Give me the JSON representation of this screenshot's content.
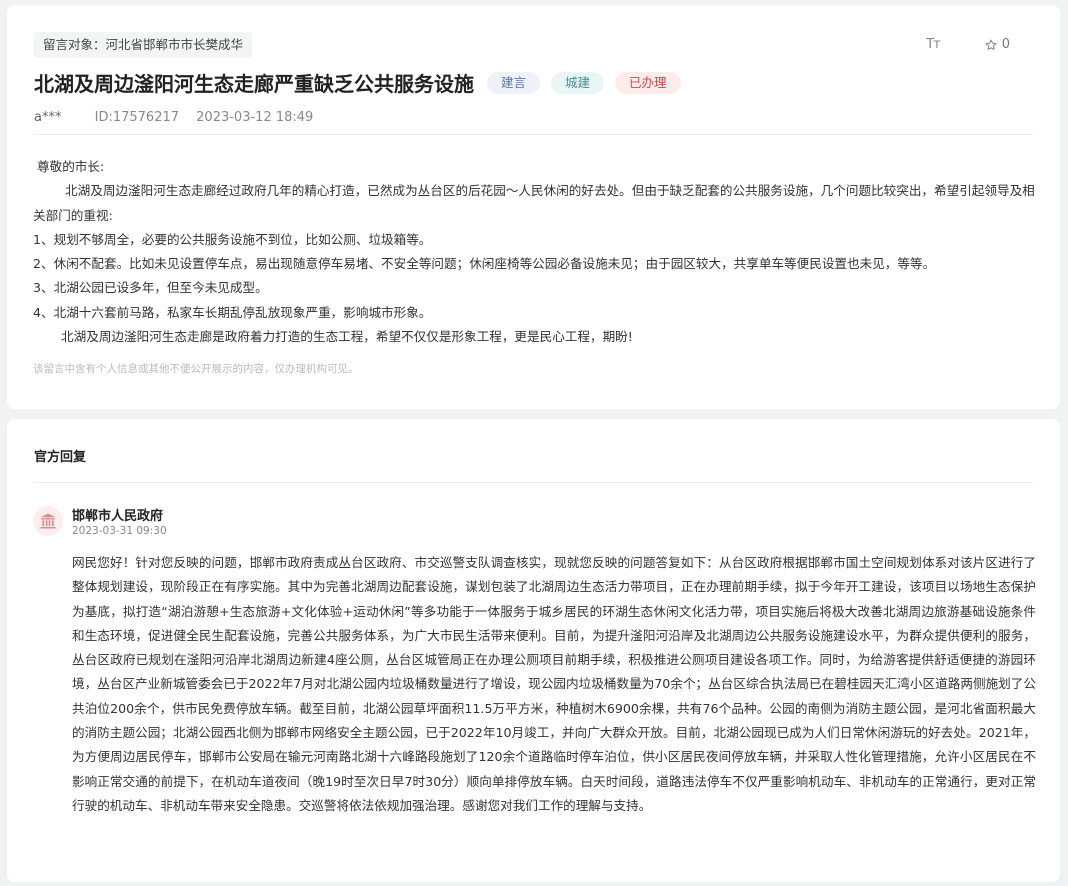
{
  "message": {
    "target": "留言对象：河北省邯郸市市长樊成华",
    "font_tool": "Tт",
    "favorite_count": "0",
    "title": "北湖及周边滏阳河生态走廊严重缺乏公共服务设施",
    "tags": [
      {
        "label": "建言",
        "color": "#5a78a8"
      },
      {
        "label": "城建",
        "color": "#3f8f96"
      },
      {
        "label": "已办理",
        "color": "#d9434b"
      }
    ],
    "author": "a***",
    "id": "ID:17576217",
    "datetime": "2023-03-12 18:49",
    "body": [
      " 尊敬的市长:",
      "        北湖及周边滏阳河生态走廊经过政府几年的精心打造，已然成为丛台区的后花园～人民休闲的好去处。但由于缺乏配套的公共服务设施，几个问题比较突出，希望引起领导及相关部门的重视:",
      "1、规划不够周全，必要的公共服务设施不到位，比如公厕、垃圾箱等。",
      "2、休闲不配套。比如未见设置停车点，易出现随意停车易堵、不安全等问题；休闲座椅等公园必备设施未见；由于园区较大，共享单车等便民设置也未见，等等。",
      "3、北湖公园已设多年，但至今未见成型。",
      "4、北湖十六套前马路，私家车长期乱停乱放现象严重，影响城市形象。",
      "       北湖及周边滏阳河生态走廊是政府着力打造的生态工程，希望不仅仅是形象工程，更是民心工程，期盼!"
    ],
    "privacy_notice": "该留言中含有个人信息或其他不便公开展示的内容，仅办理机构可见。"
  },
  "reply": {
    "section_title": "官方回复",
    "org_icon": "government-building-icon",
    "org_name": "邯郸市人民政府",
    "date": "2023-03-31 09:30",
    "text": "网民您好！针对您反映的问题，邯郸市政府责成丛台区政府、市交巡警支队调查核实，现就您反映的问题答复如下：从台区政府根据邯郸市国土空间规划体系对该片区进行了整体规划建设，现阶段正在有序实施。其中为完善北湖周边配套设施，谋划包装了北湖周边生态活力带项目，正在办理前期手续，拟于今年开工建设，该项目以场地生态保护为基底，拟打造“湖泊游憩+生态旅游+文化体验+运动休闲”等多功能于一体服务于城乡居民的环湖生态休闲文化活力带，项目实施后将极大改善北湖周边旅游基础设施条件和生态环境，促进健全民生配套设施，完善公共服务体系，为广大市民生活带来便利。目前，为提升滏阳河沿岸及北湖周边公共服务设施建设水平，为群众提供便利的服务，丛台区政府已规划在滏阳河沿岸北湖周边新建4座公厕，丛台区城管局正在办理公厕项目前期手续，积极推进公厕项目建设各项工作。同时，为给游客提供舒适便捷的游园环境，丛台区产业新城管委会已于2022年7月对北湖公园内垃圾桶数量进行了增设，现公园内垃圾桶数量为70余个；丛台区综合执法局已在碧桂园天汇湾小区道路两侧施划了公共泊位200余个，供市民免费停放车辆。截至目前，北湖公园草坪面积11.5万平方米，种植树木6900余棵，共有76个品种。公园的南侧为消防主题公园，是河北省面积最大的消防主题公园；北湖公园西北侧为邯郸市网络安全主题公园，已于2022年10月竣工，并向广大群众开放。目前，北湖公园现已成为人们日常休闲游玩的好去处。2021年，为方便周边居民停车，邯郸市公安局在输元河南路北湖十六峰路段施划了120余个道路临时停车泊位，供小区居民夜间停放车辆，并采取人性化管理措施，允许小区居民在不影响正常交通的前提下，在机动车道夜间（晚19时至次日早7时30分）顺向单排停放车辆。白天时间段，道路违法停车不仅严重影响机动车、非机动车的正常通行，更对正常行驶的机动车、非机动车带来安全隐患。交巡警将依法依规加强治理。感谢您对我们工作的理解与支持。"
  }
}
